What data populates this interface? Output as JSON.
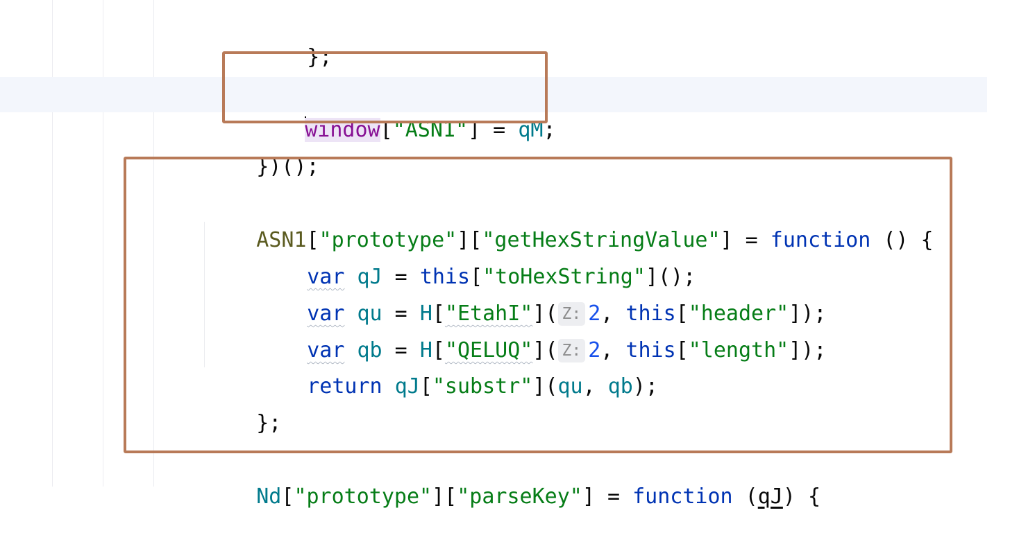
{
  "editor": {
    "lines": [
      {
        "id": "l1",
        "tokens": [
          "};"
        ]
      },
      {
        "id": "l2",
        "tokens": [
          "window",
          "[",
          "\"ASN1\"",
          "] = ",
          "qM",
          ";"
        ]
      },
      {
        "id": "l3",
        "tokens": [
          "})();"
        ]
      },
      {
        "id": "l4",
        "tokens": [
          "ASN1",
          "[",
          "\"prototype\"",
          "][",
          "\"getHexStringValue\"",
          "] = ",
          "function",
          " () {"
        ]
      },
      {
        "id": "l5",
        "tokens": [
          "var",
          " ",
          "qJ",
          " = ",
          "this",
          "[",
          "\"toHexString\"",
          "]();"
        ]
      },
      {
        "id": "l6",
        "tokens": [
          "var",
          " ",
          "qu",
          " = ",
          "H",
          "[",
          "\"EtahI\"",
          "](",
          "Z:",
          "2",
          ", ",
          "this",
          "[",
          "\"header\"",
          "]);"
        ]
      },
      {
        "id": "l7",
        "tokens": [
          "var",
          " ",
          "qb",
          " = ",
          "H",
          "[",
          "\"QELUQ\"",
          "](",
          "Z:",
          "2",
          ", ",
          "this",
          "[",
          "\"length\"",
          "]);"
        ]
      },
      {
        "id": "l8",
        "tokens": [
          "return",
          " ",
          "qJ",
          "[",
          "\"substr\"",
          "](",
          "qu",
          ", ",
          "qb",
          ");"
        ]
      },
      {
        "id": "l9",
        "tokens": [
          "};"
        ]
      },
      {
        "id": "l10",
        "tokens": [
          "Nd",
          "[",
          "\"prototype\"",
          "][",
          "\"parseKey\"",
          "] = ",
          "function",
          " (",
          "qJ",
          ") {"
        ]
      }
    ]
  },
  "colors": {
    "highlight_box": "#b87a58",
    "keyword": "#0033b3",
    "string": "#067d17",
    "identifier": "#007a8c",
    "number": "#1750eb",
    "global": "#871094"
  }
}
